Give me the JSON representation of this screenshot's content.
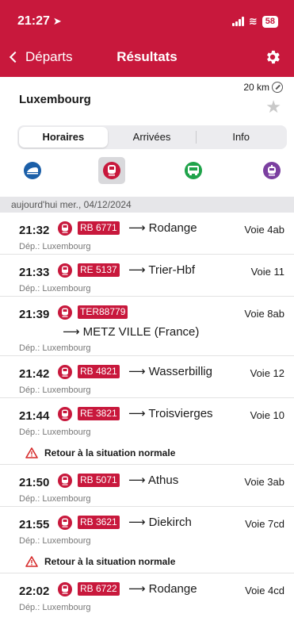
{
  "status": {
    "time": "21:27",
    "battery": "58"
  },
  "nav": {
    "back_label": "Départs",
    "title": "Résultats"
  },
  "station": {
    "name": "Luxembourg",
    "distance": "20 km"
  },
  "tabs": [
    {
      "label": "Horaires",
      "active": true
    },
    {
      "label": "Arrivées",
      "active": false
    },
    {
      "label": "Info",
      "active": false
    }
  ],
  "modes": [
    {
      "icon": "high-speed-train-icon",
      "color": "#1b5fa8",
      "selected": false
    },
    {
      "icon": "regional-train-icon",
      "color": "#c8183c",
      "selected": true
    },
    {
      "icon": "bus-icon",
      "color": "#1fa34a",
      "selected": false
    },
    {
      "icon": "tram-icon",
      "color": "#7b3fa0",
      "selected": false
    }
  ],
  "date_label": "aujourd'hui mer., 04/12/2024",
  "departures": [
    {
      "time": "21:32",
      "train": "RB 6771",
      "dest": "Rodange",
      "voie": "Voie 4ab",
      "dep": "Dép.: Luxembourg"
    },
    {
      "time": "21:33",
      "train": "RE 5137",
      "dest": "Trier-Hbf",
      "voie": "Voie 11",
      "dep": "Dép.: Luxembourg"
    },
    {
      "time": "21:39",
      "train": "TER88779",
      "dest": "METZ VILLE (France)",
      "voie": "Voie 8ab",
      "dep": "Dép.: Luxembourg"
    },
    {
      "time": "21:42",
      "train": "RB 4821",
      "dest": "Wasserbillig",
      "voie": "Voie 12",
      "dep": "Dép.: Luxembourg"
    },
    {
      "time": "21:44",
      "train": "RE 3821",
      "dest": "Troisvierges",
      "voie": "Voie 10",
      "dep": "Dép.: Luxembourg",
      "alert": "Retour à la situation normale"
    },
    {
      "time": "21:50",
      "train": "RB 5071",
      "dest": "Athus",
      "voie": "Voie 3ab",
      "dep": "Dép.: Luxembourg"
    },
    {
      "time": "21:55",
      "train": "RB 3621",
      "dest": "Diekirch",
      "voie": "Voie 7cd",
      "dep": "Dép.: Luxembourg",
      "alert": "Retour à la situation normale"
    },
    {
      "time": "22:02",
      "train": "RB 6722",
      "dest": "Rodange",
      "voie": "Voie 4cd",
      "dep": "Dép.: Luxembourg"
    }
  ],
  "colors": {
    "brand": "#c8183c"
  }
}
